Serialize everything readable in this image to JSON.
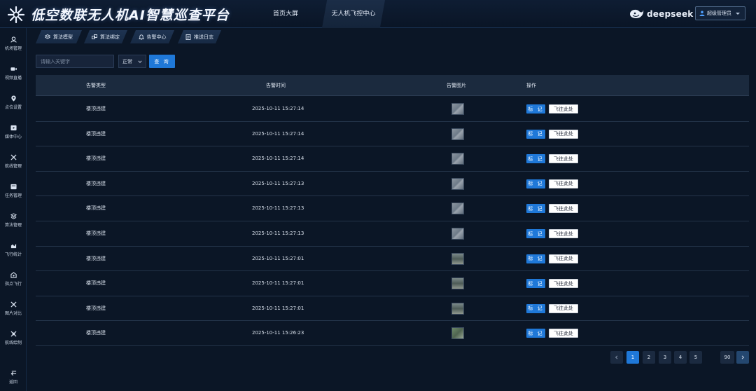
{
  "header": {
    "title": "低空数联无人机AI智慧巡查平台",
    "nav": [
      "首页大屏",
      "无人机飞控中心"
    ],
    "brand": "deepseek",
    "user": "超级管理员"
  },
  "sidebar": {
    "items": [
      {
        "label": "机场管理",
        "icon": "hangar-icon"
      },
      {
        "label": "视频直播",
        "icon": "video-icon"
      },
      {
        "label": "点位设置",
        "icon": "location-pin-icon"
      },
      {
        "label": "媒体中心",
        "icon": "media-icon"
      },
      {
        "label": "航线管理",
        "icon": "route-icon"
      },
      {
        "label": "任务管理",
        "icon": "task-icon"
      },
      {
        "label": "算法管理",
        "icon": "algorithm-icon"
      },
      {
        "label": "飞行统计",
        "icon": "chart-icon"
      },
      {
        "label": "指点飞行",
        "icon": "drone-icon"
      },
      {
        "label": "图片对比",
        "icon": "compare-icon"
      },
      {
        "label": "航线绘制",
        "icon": "draw-route-icon"
      }
    ],
    "back": "返回"
  },
  "subtabs": [
    {
      "label": "算法模型",
      "icon": "layers-icon"
    },
    {
      "label": "算法绑定",
      "icon": "link-icon"
    },
    {
      "label": "告警中心",
      "icon": "bell-icon"
    },
    {
      "label": "推送日志",
      "icon": "log-icon"
    }
  ],
  "filters": {
    "search_placeholder": "请输入关键字",
    "status_value": "正常",
    "query_label": "查 询"
  },
  "table": {
    "columns": [
      "告警类型",
      "告警时间",
      "告警图片",
      "操作"
    ],
    "rows": [
      {
        "type": "楼顶违建",
        "time": "2025-10-11 15:27:14",
        "thumb": "gray"
      },
      {
        "type": "楼顶违建",
        "time": "2025-10-11 15:27:14",
        "thumb": "gray"
      },
      {
        "type": "楼顶违建",
        "time": "2025-10-11 15:27:14",
        "thumb": "gray"
      },
      {
        "type": "楼顶违建",
        "time": "2025-10-11 15:27:13",
        "thumb": "gray"
      },
      {
        "type": "楼顶违建",
        "time": "2025-10-11 15:27:13",
        "thumb": "gray"
      },
      {
        "type": "楼顶违建",
        "time": "2025-10-11 15:27:13",
        "thumb": "gray"
      },
      {
        "type": "楼顶违建",
        "time": "2025-10-11 15:27:01",
        "thumb": "street"
      },
      {
        "type": "楼顶违建",
        "time": "2025-10-11 15:27:01",
        "thumb": "street"
      },
      {
        "type": "楼顶违建",
        "time": "2025-10-11 15:27:01",
        "thumb": "street"
      },
      {
        "type": "楼顶违建",
        "time": "2025-10-11 15:26:23",
        "thumb": "green"
      }
    ],
    "mark_label": "标 记",
    "goto_label": "飞往此处"
  },
  "pagination": {
    "pages": [
      "1",
      "2",
      "3",
      "4",
      "5"
    ],
    "last_page": "90",
    "current": "1"
  },
  "colors": {
    "accent": "#1f78d8",
    "background": "#0b1626",
    "header_row": "#1b2a3e"
  }
}
